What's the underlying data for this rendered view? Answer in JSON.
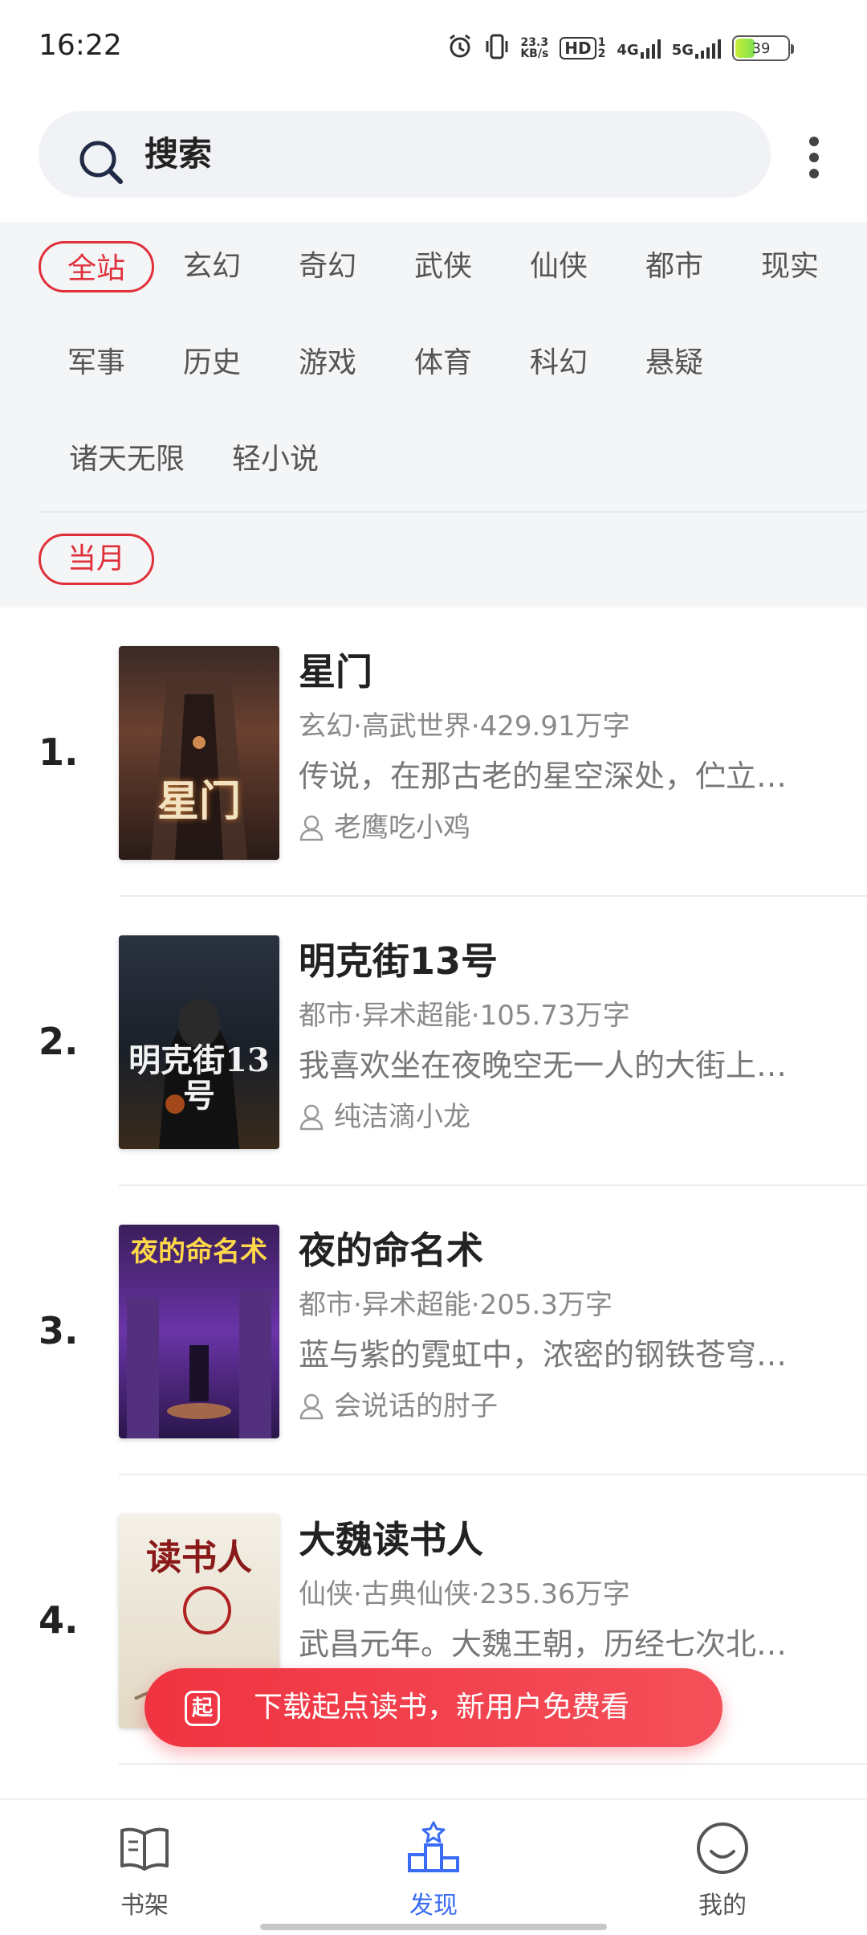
{
  "status_bar": {
    "time": "16:22",
    "net_speed": "23.3",
    "net_speed_unit": "KB/s",
    "hd": "HD",
    "hd_sub_top": "1",
    "hd_sub_bottom": "2",
    "net_4g": "4G",
    "net_5g": "5G",
    "battery": "39",
    "icons": [
      "alarm-icon",
      "vibrate-icon",
      "signal-icon",
      "battery-icon"
    ]
  },
  "search": {
    "label": "搜索",
    "icon": "search-icon",
    "more_icon": "more-vert-icon"
  },
  "categories": {
    "active": "全站",
    "rows": [
      [
        "全站",
        "玄幻",
        "奇幻",
        "武侠",
        "仙侠",
        "都市",
        "现实"
      ],
      [
        "军事",
        "历史",
        "游戏",
        "体育",
        "科幻",
        "悬疑"
      ],
      [
        "诸天无限",
        "轻小说"
      ]
    ]
  },
  "period": {
    "label": "当月"
  },
  "books": [
    {
      "rank": "1.",
      "title": "星门",
      "meta": "玄幻·高武世界·429.91万字",
      "intro": "传说，在那古老的星空深处，伫立…",
      "author": "老鹰吃小鸡",
      "cover_title": "星门",
      "cover_colors": [
        "#2a1e1c",
        "#7a4a32",
        "#c9a46a"
      ]
    },
    {
      "rank": "2.",
      "title": "明克街13号",
      "meta": "都市·异术超能·105.73万字",
      "intro": "我喜欢坐在夜晚空无一人的大街上…",
      "author": "纯洁滴小龙",
      "cover_title": "明克街13号",
      "cover_colors": [
        "#1c2430",
        "#3b4656",
        "#7a5a3a"
      ]
    },
    {
      "rank": "3.",
      "title": "夜的命名术",
      "meta": "都市·异术超能·205.3万字",
      "intro": "蓝与紫的霓虹中，浓密的钢铁苍穹…",
      "author": "会说话的肘子",
      "cover_title": "夜的命名术",
      "cover_colors": [
        "#2b1b4e",
        "#6a3aa8",
        "#e0a23a"
      ]
    },
    {
      "rank": "4.",
      "title": "大魏读书人",
      "meta": "仙侠·古典仙侠·235.36万字",
      "intro": "武昌元年。大魏王朝，历经七次北…",
      "author": "",
      "cover_title": "读书人",
      "cover_colors": [
        "#efe9dd",
        "#d8cdb8",
        "#b22222"
      ]
    }
  ],
  "promo": {
    "logo": "起",
    "text": "下载起点读书，新用户免费看"
  },
  "bottom_nav": {
    "items": [
      {
        "label": "书架",
        "icon": "bookshelf-icon"
      },
      {
        "label": "发现",
        "icon": "discover-icon"
      },
      {
        "label": "我的",
        "icon": "profile-icon"
      }
    ],
    "active": "发现",
    "accent": "#3a6cf4"
  },
  "colors": {
    "accent_red": "#e0303a",
    "accent_blue": "#3a6cf4"
  }
}
